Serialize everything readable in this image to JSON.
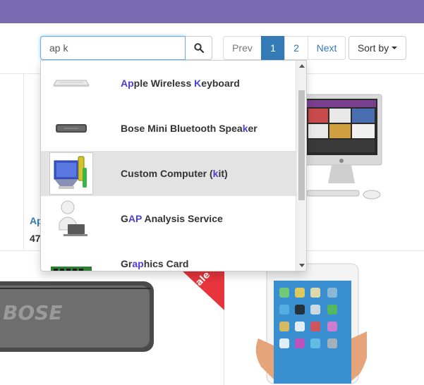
{
  "search": {
    "query": "ap k",
    "icon": "search-icon"
  },
  "pagination": {
    "prev": "Prev",
    "pages": [
      "1",
      "2"
    ],
    "active_page": "1",
    "next": "Next"
  },
  "sort": {
    "label": "Sort by"
  },
  "grid": {
    "product_name_partial": "Ap",
    "product_price_partial": "47",
    "sale_badge": "ale"
  },
  "autocomplete": {
    "items": [
      {
        "segments": [
          {
            "t": "Ap",
            "h": true
          },
          {
            "t": "ple Wireless ",
            "h": false
          },
          {
            "t": "K",
            "h": true
          },
          {
            "t": "eyboard",
            "h": false
          }
        ],
        "thumb": "keyboard-thumbnail"
      },
      {
        "segments": [
          {
            "t": "Bose Mini Bluetooth Spea",
            "h": false
          },
          {
            "t": "k",
            "h": true
          },
          {
            "t": "er",
            "h": false
          }
        ],
        "thumb": "speaker-thumbnail"
      },
      {
        "segments": [
          {
            "t": "Custom Computer (",
            "h": false
          },
          {
            "t": "k",
            "h": true
          },
          {
            "t": "it)",
            "h": false
          }
        ],
        "thumb": "computer-kit-thumbnail",
        "highlighted": true
      },
      {
        "segments": [
          {
            "t": "G",
            "h": false
          },
          {
            "t": "AP",
            "h": true
          },
          {
            "t": " Analysis Service",
            "h": false
          }
        ],
        "thumb": "analysis-service-thumbnail"
      },
      {
        "segments": [
          {
            "t": "Gr",
            "h": false
          },
          {
            "t": "ap",
            "h": true
          },
          {
            "t": "hics Card",
            "h": false
          }
        ],
        "thumb": "graphics-card-thumbnail"
      }
    ]
  },
  "colors": {
    "topbar": "#7b6bb2",
    "primary": "#337ab7",
    "highlight_text": "#4a3fd6",
    "sale_ribbon": "#e8343c"
  }
}
